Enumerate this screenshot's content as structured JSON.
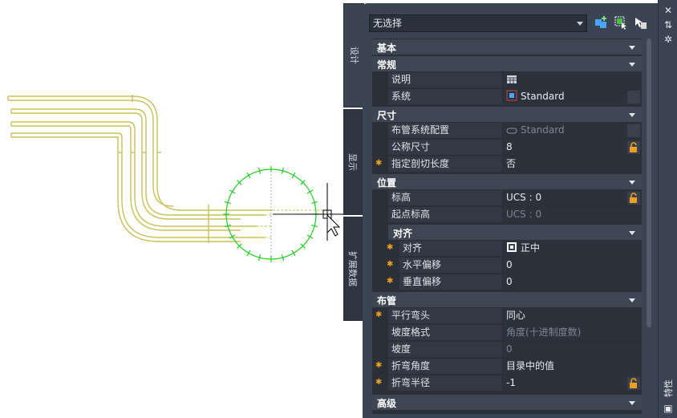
{
  "palette": {
    "selector_value": "无选择",
    "side_tabs": [
      "设计",
      "显示",
      "扩展数据"
    ],
    "title": "特性",
    "categories": {
      "basic": "基本",
      "general": "常规",
      "dimensions": "尺寸",
      "location": "位置",
      "justification": "对齐",
      "routing": "布管",
      "advanced": "高级"
    },
    "props": {
      "description": {
        "name": "说明",
        "value": ""
      },
      "system": {
        "name": "系统",
        "value": "Standard"
      },
      "routing_pref": {
        "name": "布管系统配置",
        "value": "Standard"
      },
      "nominal_size": {
        "name": "公称尺寸",
        "value": "8"
      },
      "specify_cut_length": {
        "name": "指定剖切长度",
        "value": "否"
      },
      "elevation": {
        "name": "标高",
        "value": "UCS : 0"
      },
      "start_elevation": {
        "name": "起点标高",
        "value": "UCS : 0"
      },
      "justify": {
        "name": "对齐",
        "value": "正中"
      },
      "horizontal_offset": {
        "name": "水平偏移",
        "value": "0"
      },
      "vertical_offset": {
        "name": "垂直偏移",
        "value": "0"
      },
      "parallel_bend": {
        "name": "平行弯头",
        "value": "同心"
      },
      "slope_format": {
        "name": "坡度格式",
        "value": "角度(十进制度数)"
      },
      "slope": {
        "name": "坡度",
        "value": "0"
      },
      "bend_angle": {
        "name": "折弯角度",
        "value": "目录中的值"
      },
      "bend_radius": {
        "name": "折弯半径",
        "value": "-1"
      }
    }
  },
  "colors": {
    "pipe": "#c8c05a",
    "compass": "#22cc22",
    "accent_star": "#f0a020"
  }
}
